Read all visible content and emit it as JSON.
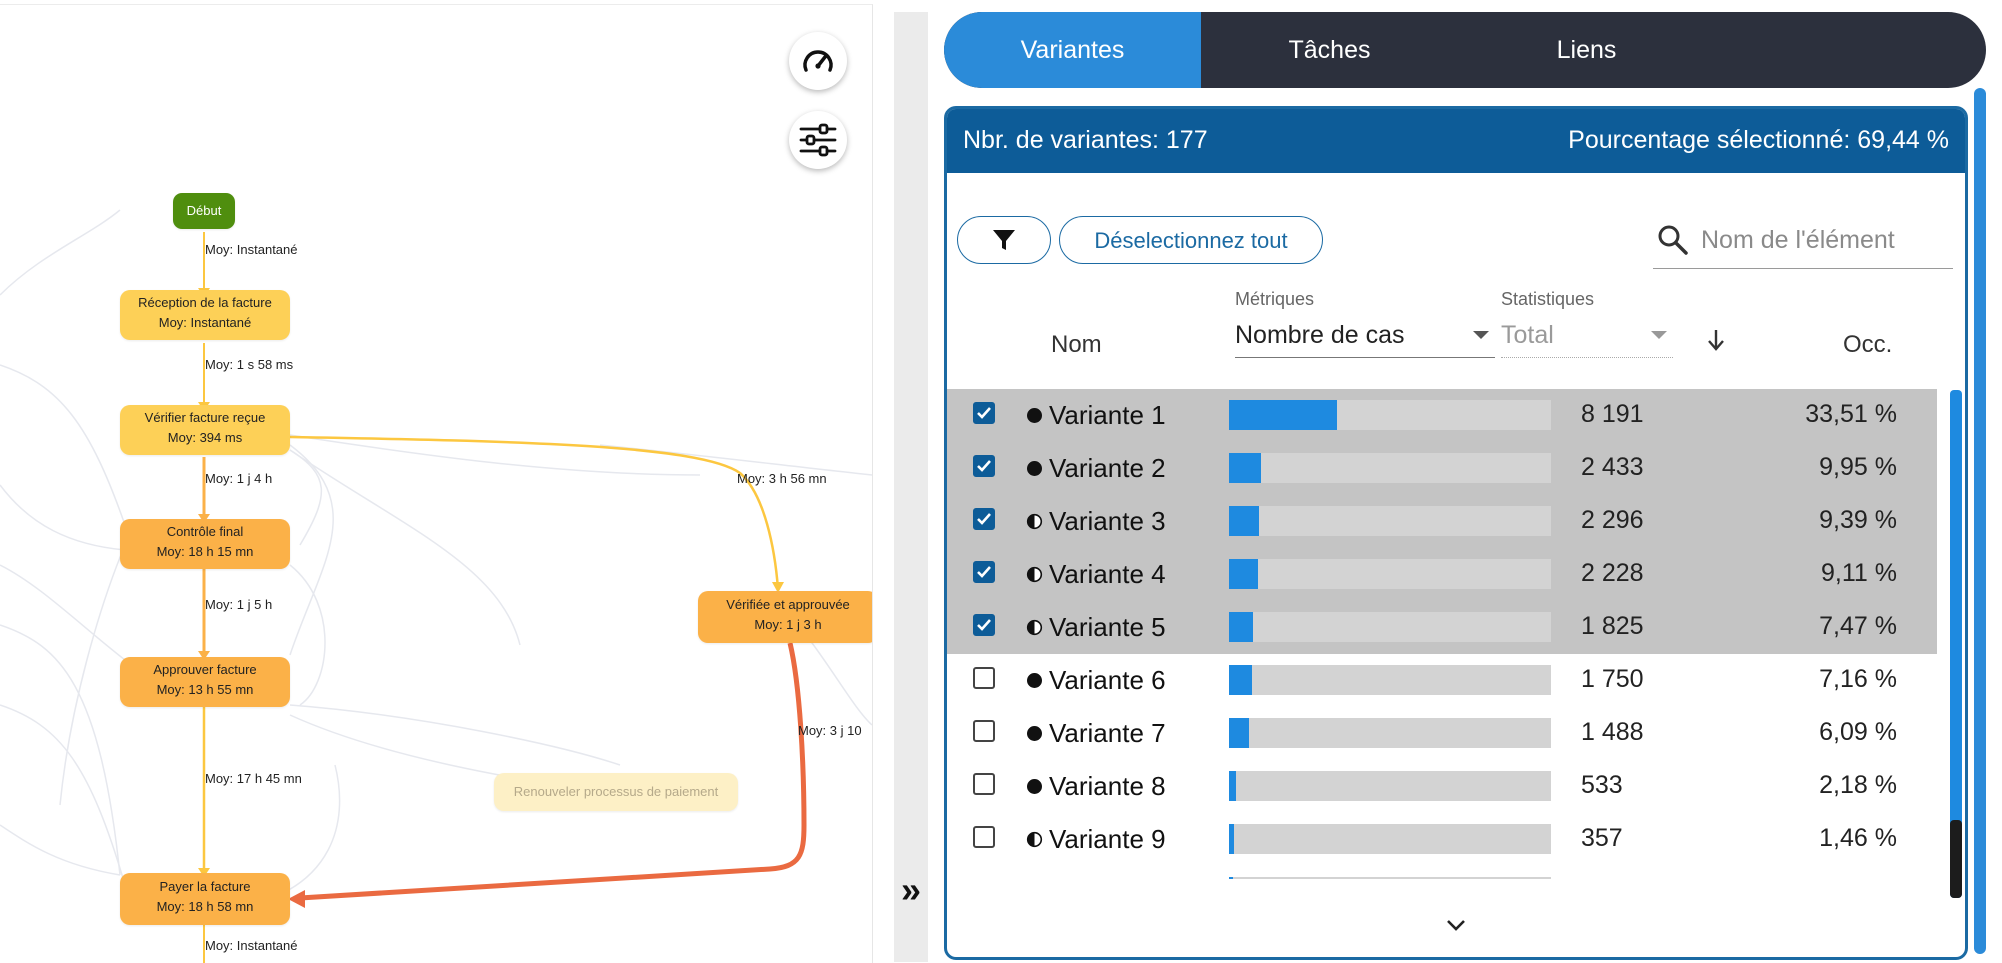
{
  "process_map": {
    "nodes": [
      {
        "id": "debut",
        "line1": "Début",
        "line2": "",
        "style": "start"
      },
      {
        "id": "reception",
        "line1": "Réception de la facture",
        "line2": "Moy: Instantané",
        "style": "light"
      },
      {
        "id": "verifier",
        "line1": "Vérifier facture reçue",
        "line2": "Moy: 394 ms",
        "style": "light"
      },
      {
        "id": "controle",
        "line1": "Contrôle final",
        "line2": "Moy: 18 h 15 mn",
        "style": "mid"
      },
      {
        "id": "approuver",
        "line1": "Approuver facture",
        "line2": "Moy: 13 h 55 mn",
        "style": "mid"
      },
      {
        "id": "verifiee",
        "line1": "Vérifiée et approuvée",
        "line2": "Moy: 1 j 3 h",
        "style": "mid"
      },
      {
        "id": "renouveler",
        "line1": "Renouveler processus de paiement",
        "line2": "",
        "style": "faded"
      },
      {
        "id": "payer",
        "line1": "Payer la facture",
        "line2": "Moy: 18 h 58 mn",
        "style": "mid"
      }
    ],
    "edge_labels": [
      "Moy: Instantané",
      "Moy: 1 s 58 ms",
      "Moy: 1 j 4 h",
      "Moy: 3 h 56 mn",
      "Moy: 1 j 5 h",
      "Moy: 3 j 10",
      "Moy: 17 h 45 mn",
      "Moy: Instantané"
    ],
    "colors": {
      "start": "#4f8e0e",
      "light": "#fdd057",
      "mid": "#fbb148",
      "hot_edge": "#ea6a41",
      "faded_edge": "#e6e8ee"
    }
  },
  "map_controls": {
    "speed_icon": "speedometer-icon",
    "settings_icon": "sliders-icon"
  },
  "splitter": {
    "collapse_glyph": "»"
  },
  "tabs": [
    {
      "label": "Variantes",
      "active": true
    },
    {
      "label": "Tâches",
      "active": false
    },
    {
      "label": "Liens",
      "active": false
    }
  ],
  "panel": {
    "count_label": "Nbr. de variantes: 177",
    "selected_label": "Pourcentage sélectionné: 69,44 %",
    "filter_icon": "filter-icon",
    "deselect_label": "Déselectionnez tout",
    "search_placeholder": "Nom de l'élément",
    "headers": {
      "name": "Nom",
      "metrics_label": "Métriques",
      "metrics_value": "Nombre de cas",
      "stats_label": "Statistiques",
      "stats_value": "Total",
      "sort_icon": "arrow-down-icon",
      "occ": "Occ."
    },
    "rows": [
      {
        "name": "Variante 1",
        "icon": "full-circle",
        "count": "8 191",
        "pct": "33,51 %",
        "selected": true,
        "share": 0.3351
      },
      {
        "name": "Variante 2",
        "icon": "full-circle",
        "count": "2 433",
        "pct": "9,95 %",
        "selected": true,
        "share": 0.0995
      },
      {
        "name": "Variante 3",
        "icon": "half-circle",
        "count": "2 296",
        "pct": "9,39 %",
        "selected": true,
        "share": 0.0939
      },
      {
        "name": "Variante 4",
        "icon": "half-circle",
        "count": "2 228",
        "pct": "9,11 %",
        "selected": true,
        "share": 0.0911
      },
      {
        "name": "Variante 5",
        "icon": "half-circle",
        "count": "1 825",
        "pct": "7,47 %",
        "selected": true,
        "share": 0.0747
      },
      {
        "name": "Variante 6",
        "icon": "full-circle",
        "count": "1 750",
        "pct": "7,16 %",
        "selected": false,
        "share": 0.0716
      },
      {
        "name": "Variante 7",
        "icon": "full-circle",
        "count": "1 488",
        "pct": "6,09 %",
        "selected": false,
        "share": 0.0609
      },
      {
        "name": "Variante 8",
        "icon": "full-circle",
        "count": "533",
        "pct": "2,18 %",
        "selected": false,
        "share": 0.0218
      },
      {
        "name": "Variante 9",
        "icon": "half-circle",
        "count": "357",
        "pct": "1,46 %",
        "selected": false,
        "share": 0.0146
      }
    ],
    "more_icon": "chevron-down-icon",
    "colors": {
      "header": "#0d5c98",
      "active_tab": "#2b8bd9",
      "tabs_bg": "#2c303d",
      "bar_fill": "#1e8ae0",
      "bar_bg": "#d3d3d3",
      "selected_row": "#c4c4c4"
    }
  }
}
